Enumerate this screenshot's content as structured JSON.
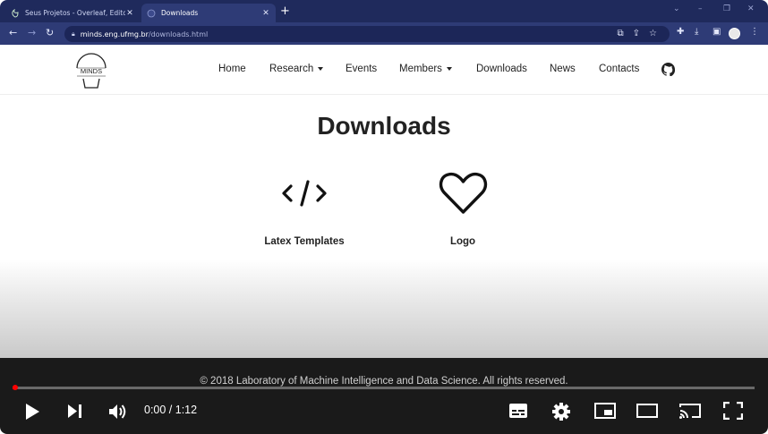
{
  "browser": {
    "tabs": [
      {
        "title": "Seus Projetos - Overleaf, Editor L",
        "favicon": "overleaf-leaf-icon",
        "active": false
      },
      {
        "title": "Downloads",
        "favicon": "globe-icon",
        "active": true
      }
    ],
    "url_host": "minds.eng.ufmg.br",
    "url_path": "/downloads.html"
  },
  "site": {
    "logo_text": "MINDS",
    "nav": [
      {
        "label": "Home",
        "dropdown": false
      },
      {
        "label": "Research",
        "dropdown": true
      },
      {
        "label": "Events",
        "dropdown": false
      },
      {
        "label": "Members",
        "dropdown": true
      },
      {
        "label": "Downloads",
        "dropdown": false
      },
      {
        "label": "News",
        "dropdown": false
      },
      {
        "label": "Contacts",
        "dropdown": false
      }
    ],
    "github_icon": "github-icon"
  },
  "main": {
    "title": "Downloads",
    "items": [
      {
        "label": "Latex Templates",
        "icon": "code-icon"
      },
      {
        "label": "Logo",
        "icon": "heart-icon"
      }
    ]
  },
  "footer": {
    "copyright": "© 2018 Laboratory of Machine Intelligence and Data Science. All rights reserved."
  },
  "player": {
    "time": "0:00 / 1:12",
    "progress": 0.003,
    "accent": "#ff0000"
  }
}
